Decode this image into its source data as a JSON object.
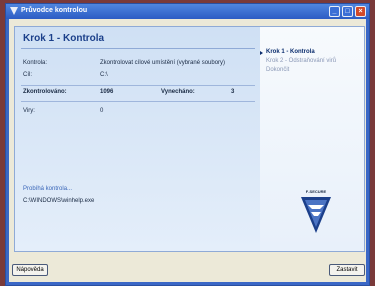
{
  "window": {
    "title": "Průvodce kontrolou"
  },
  "main": {
    "heading": "Krok 1 - Kontrola",
    "rows": [
      {
        "label": "Kontrola:",
        "value": "Zkontrolovat cílové umístění (vybrané soubory)"
      },
      {
        "label": "Cíl:",
        "value": "C:\\"
      }
    ],
    "checked_label": "Zkontrolováno:",
    "checked_value": "1096",
    "skipped_label": "Vynecháno:",
    "skipped_value": "3",
    "viruses_label": "Viry:",
    "viruses_value": "0",
    "progress_label": "Probíhá kontrola...",
    "current_file": "C:\\WINDOWS\\winhelp.exe"
  },
  "steps": [
    {
      "label": "Krok 1 - Kontrola",
      "active": true
    },
    {
      "label": "Krok 2 - Odstraňování virů",
      "active": false
    },
    {
      "label": "Dokončit",
      "active": false
    }
  ],
  "brand": {
    "name": "F-SECURE",
    "colors": {
      "accent": "#1b3f8a",
      "panel": "#cfe0f4"
    }
  },
  "buttons": {
    "help": "Nápověda",
    "stop": "Zastavit"
  }
}
